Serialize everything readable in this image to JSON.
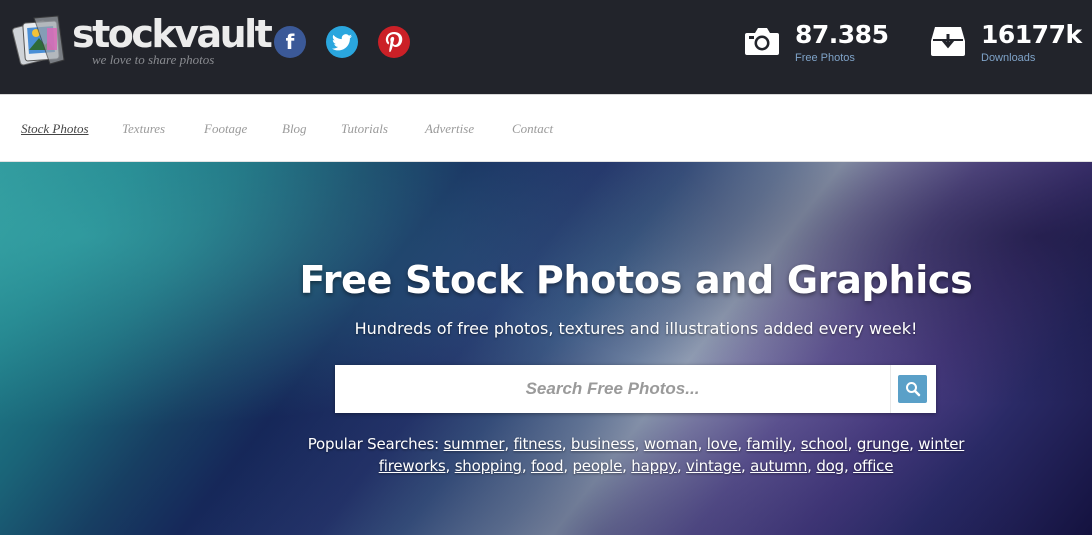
{
  "header": {
    "logo_name": "stockvault",
    "logo_tagline": "we love to share photos",
    "social": [
      {
        "name": "facebook",
        "glyph": "f",
        "color": "#3b5998"
      },
      {
        "name": "twitter",
        "color": "#2aa6de"
      },
      {
        "name": "pinterest",
        "color": "#cb2027"
      }
    ],
    "stats": [
      {
        "icon": "camera-icon",
        "value": "87.385",
        "label": "Free Photos"
      },
      {
        "icon": "download-box-icon",
        "value": "16177k",
        "label": "Downloads"
      }
    ]
  },
  "nav": {
    "items": [
      {
        "label": "Stock Photos",
        "active": true
      },
      {
        "label": "Textures"
      },
      {
        "label": "Footage"
      },
      {
        "label": "Blog"
      },
      {
        "label": "Tutorials"
      },
      {
        "label": "Advertise"
      },
      {
        "label": "Contact"
      }
    ]
  },
  "hero": {
    "title": "Free Stock Photos and Graphics",
    "subtitle": "Hundreds of free photos, textures and illustrations added every week!",
    "search_placeholder": "Search Free Photos...",
    "search_button_icon": "magnifier-icon",
    "popular_label": "Popular Searches:",
    "popular_terms": [
      "summer",
      "fitness",
      "business",
      "woman",
      "love",
      "family",
      "school",
      "grunge",
      "winter",
      "fireworks",
      "shopping",
      "food",
      "people",
      "happy",
      "vintage",
      "autumn",
      "dog",
      "office"
    ]
  },
  "colors": {
    "topbar_bg": "#22242b",
    "stat_label": "#7fa3c8",
    "search_button": "#5aa0c8"
  }
}
